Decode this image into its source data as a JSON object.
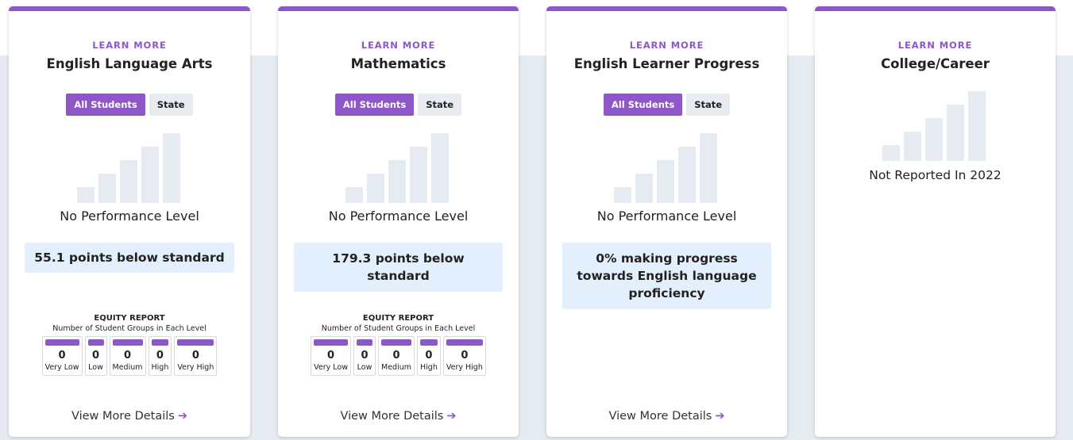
{
  "cards": [
    {
      "learn_more": "LEARN MORE",
      "title": "English Language Arts",
      "toggle": {
        "active": "All Students",
        "inactive": "State"
      },
      "performance_level": "No Performance Level",
      "status": "55.1 points below standard",
      "equity": {
        "title": "EQUITY REPORT",
        "subtitle": "Number of Student Groups in Each Level",
        "levels": [
          {
            "label": "Very Low",
            "count": "0"
          },
          {
            "label": "Low",
            "count": "0"
          },
          {
            "label": "Medium",
            "count": "0"
          },
          {
            "label": "High",
            "count": "0"
          },
          {
            "label": "Very High",
            "count": "0"
          }
        ]
      },
      "view_more": "View More Details",
      "view_more_arrow": "➔"
    },
    {
      "learn_more": "LEARN MORE",
      "title": "Mathematics",
      "toggle": {
        "active": "All Students",
        "inactive": "State"
      },
      "performance_level": "No Performance Level",
      "status": "179.3 points below standard",
      "equity": {
        "title": "EQUITY REPORT",
        "subtitle": "Number of Student Groups in Each Level",
        "levels": [
          {
            "label": "Very Low",
            "count": "0"
          },
          {
            "label": "Low",
            "count": "0"
          },
          {
            "label": "Medium",
            "count": "0"
          },
          {
            "label": "High",
            "count": "0"
          },
          {
            "label": "Very High",
            "count": "0"
          }
        ]
      },
      "view_more": "View More Details",
      "view_more_arrow": "➔"
    },
    {
      "learn_more": "LEARN MORE",
      "title": "English Learner Progress",
      "toggle": {
        "active": "All Students",
        "inactive": "State"
      },
      "performance_level": "No Performance Level",
      "status": "0% making progress towards English language proficiency",
      "view_more": "View More Details",
      "view_more_arrow": "➔"
    },
    {
      "learn_more": "LEARN MORE",
      "title": "College/Career",
      "not_reported": "Not Reported In 2022"
    }
  ],
  "colors": {
    "accent": "#8e57c8",
    "band": "#e6ebf2",
    "status_box": "#e3effc",
    "placeholder_bar": "#e6ebf2"
  }
}
